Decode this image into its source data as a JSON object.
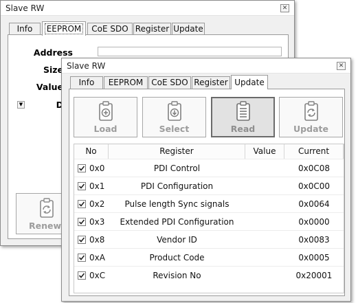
{
  "back_window": {
    "title": "Slave RW",
    "tabs": [
      "Info",
      "EEPROM",
      "CoE SDO",
      "Register",
      "Update"
    ],
    "active_tab": "EEPROM",
    "fields": {
      "address_label": "Address",
      "size_label": "Size",
      "value_label": "Value",
      "data_label": "D"
    },
    "renew_button_label": "RenewC"
  },
  "front_window": {
    "title": "Slave RW",
    "tabs": [
      "Info",
      "EEPROM",
      "CoE SDO",
      "Register",
      "Update"
    ],
    "active_tab": "Update",
    "toolbar": {
      "load_label": "Load",
      "select_label": "Select",
      "read_label": "Read",
      "update_label": "Update",
      "pressed": "Read"
    },
    "table": {
      "headers": [
        "No",
        "Register",
        "Value",
        "Current"
      ],
      "rows": [
        {
          "checked": true,
          "no": "0x0",
          "register": "PDI Control",
          "value": "",
          "current": "0x0C08"
        },
        {
          "checked": true,
          "no": "0x1",
          "register": "PDI Configuration",
          "value": "",
          "current": "0x0C00"
        },
        {
          "checked": true,
          "no": "0x2",
          "register": "Pulse length Sync signals",
          "value": "",
          "current": "0x0064"
        },
        {
          "checked": true,
          "no": "0x3",
          "register": "Extended PDI Configuration",
          "value": "",
          "current": "0x0000"
        },
        {
          "checked": true,
          "no": "0x8",
          "register": "Vendor ID",
          "value": "",
          "current": "0x0083"
        },
        {
          "checked": true,
          "no": "0xA",
          "register": "Product Code",
          "value": "",
          "current": "0x0005"
        },
        {
          "checked": true,
          "no": "0xC",
          "register": "Revision No",
          "value": "",
          "current": "0x20001"
        }
      ]
    }
  },
  "colors": {
    "window_bg": "#f0f0f0",
    "titlebar_bg": "#ffffff",
    "border": "#8a8a8a",
    "button_label": "#9c9c9c"
  }
}
